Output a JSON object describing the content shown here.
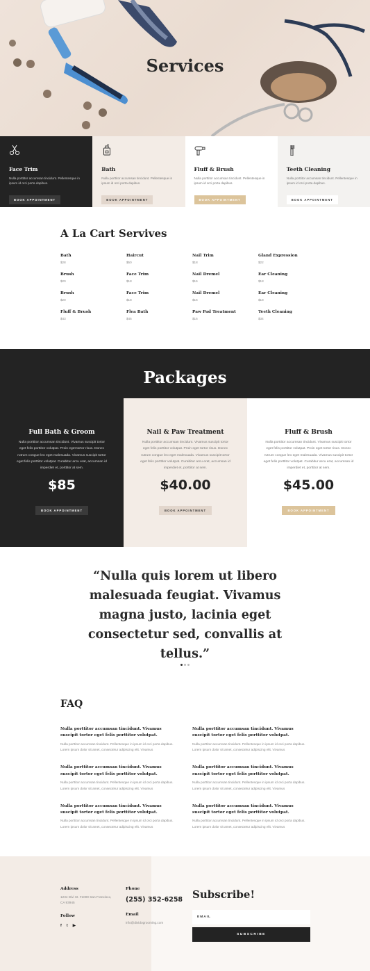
{
  "hero": {
    "title": "Services"
  },
  "cards": [
    {
      "icon": "scissors-icon",
      "title": "Face Trim",
      "text": "Nulla porttitor accumsan tincidunt. Pellentesque in ipsum id orci porta dapibus.",
      "button": "BOOK APPOINTMENT"
    },
    {
      "icon": "shampoo-bottle-icon",
      "title": "Bath",
      "text": "Nulla porttitor accumsan tincidunt. Pellentesque in ipsum id orci porta dapibus.",
      "button": "BOOK APPOINTMENT"
    },
    {
      "icon": "hair-dryer-icon",
      "title": "Fluff & Brush",
      "text": "Nulla porttitor accumsan tincidunt. Pellentesque in ipsum id orci porta dapibus.",
      "button": "BOOK APPOINTMENT"
    },
    {
      "icon": "toothbrush-icon",
      "title": "Teeth Cleaning",
      "text": "Nulla porttitor accumsan tincidunt. Pellentesque in ipsum id orci porta dapibus.",
      "button": "BOOK APPOINTMENT"
    }
  ],
  "alacart": {
    "title": "A La Cart Servives",
    "items": [
      {
        "name": "Bath",
        "price": "$28"
      },
      {
        "name": "Haircut",
        "price": "$50"
      },
      {
        "name": "Nail Trim",
        "price": "$18"
      },
      {
        "name": "Gland Expression",
        "price": "$22"
      },
      {
        "name": "Brush",
        "price": "$20"
      },
      {
        "name": "Face Trim",
        "price": "$18"
      },
      {
        "name": "Nail Dremel",
        "price": "$16"
      },
      {
        "name": "Ear Cleaning",
        "price": "$18"
      },
      {
        "name": "Brush",
        "price": "$20"
      },
      {
        "name": "Face Trim",
        "price": "$18"
      },
      {
        "name": "Nail Dremel",
        "price": "$16"
      },
      {
        "name": "Ear Cleaning",
        "price": "$18"
      },
      {
        "name": "Fluff & Brush",
        "price": "$43"
      },
      {
        "name": "Flea Bath",
        "price": "$45"
      },
      {
        "name": "Paw Pad Treatment",
        "price": "$16"
      },
      {
        "name": "Teeth Cleaning",
        "price": "$34"
      }
    ]
  },
  "packages": {
    "title": "Packages",
    "items": [
      {
        "name": "Full Bath & Groom",
        "text": "Nulla porttitor accumsan tincidunt. Vivamus suscipit tortor eget felis porttitor volutpat. Proin eget tortor risus. Donec rutrum congue leo eget malesuada. Vivamus suscipit tortor eget felis porttitor volutpat. Curabitur arcu erat, accumsan id imperdiet et, porttitor at sem.",
        "price": "$85",
        "button": "BOOK APPOINTMENT"
      },
      {
        "name": "Nail & Paw Treatment",
        "text": "Nulla porttitor accumsan tincidunt. Vivamus suscipit tortor eget felis porttitor volutpat. Proin eget tortor risus. Donec rutrum congue leo eget malesuada. Vivamus suscipit tortor eget felis porttitor volutpat. Curabitur arcu erat, accumsan id imperdiet et, porttitor at sem.",
        "price": "$40.00",
        "button": "BOOK APPOINTMENT"
      },
      {
        "name": "Fluff & Brush",
        "text": "Nulla porttitor accumsan tincidunt. Vivamus suscipit tortor eget felis porttitor volutpat. Proin eget tortor risus. Donec rutrum congue leo eget malesuada. Vivamus suscipit tortor eget felis porttitor volutpat. Curabitur arcu erat, accumsan id imperdiet et, porttitor at sem.",
        "price": "$45.00",
        "button": "BOOK APPOINTMENT"
      }
    ]
  },
  "quote": {
    "text": "“Nulla quis lorem ut libero malesuada feugiat. Vivamus magna justo, lacinia eget consectetur sed, convallis at tellus.”"
  },
  "faq": {
    "title": "FAQ",
    "items": [
      {
        "q": "Nulla porttitor accumsan tincidunt. Vivamus suscipit tortor eget felis porttitor volutpat.",
        "a": "Nulla porttitor accumsan tincidunt. Pellentesque in ipsum id orci porta dapibus. Lorem ipsum dolor sit amet, consectetur adipiscing elit. Vivamus"
      },
      {
        "q": "Nulla porttitor accumsan tincidunt. Vivamus suscipit tortor eget felis porttitor volutpat.",
        "a": "Nulla porttitor accumsan tincidunt. Pellentesque in ipsum id orci porta dapibus. Lorem ipsum dolor sit amet, consectetur adipiscing elit. Vivamus"
      },
      {
        "q": "Nulla porttitor accumsan tincidunt. Vivamus suscipit tortor eget felis porttitor volutpat.",
        "a": "Nulla porttitor accumsan tincidunt. Pellentesque in ipsum id orci porta dapibus. Lorem ipsum dolor sit amet, consectetur adipiscing elit. Vivamus"
      },
      {
        "q": "Nulla porttitor accumsan tincidunt. Vivamus suscipit tortor eget felis porttitor volutpat.",
        "a": "Nulla porttitor accumsan tincidunt. Pellentesque in ipsum id orci porta dapibus. Lorem ipsum dolor sit amet, consectetur adipiscing elit. Vivamus"
      },
      {
        "q": "Nulla porttitor accumsan tincidunt. Vivamus suscipit tortor eget felis porttitor volutpat.",
        "a": "Nulla porttitor accumsan tincidunt. Pellentesque in ipsum id orci porta dapibus. Lorem ipsum dolor sit amet, consectetur adipiscing elit. Vivamus"
      },
      {
        "q": "Nulla porttitor accumsan tincidunt. Vivamus suscipit tortor eget felis porttitor volutpat.",
        "a": "Nulla porttitor accumsan tincidunt. Pellentesque in ipsum id orci porta dapibus. Lorem ipsum dolor sit amet, consectetur adipiscing elit. Vivamus"
      }
    ]
  },
  "footer": {
    "address_label": "Address",
    "address": "1234 Divi St. #1000 San Francisco, CA 93945",
    "phone_label": "Phone",
    "phone": "(255) 352-6258",
    "follow_label": "Follow",
    "social": [
      "f",
      "t",
      "▶"
    ],
    "email_label": "Email",
    "email": "info@dividogrooming.com",
    "subscribe_title": "Subscribe!",
    "email_placeholder": "EMAIL",
    "subscribe_button": "SUBSCRIBE"
  }
}
